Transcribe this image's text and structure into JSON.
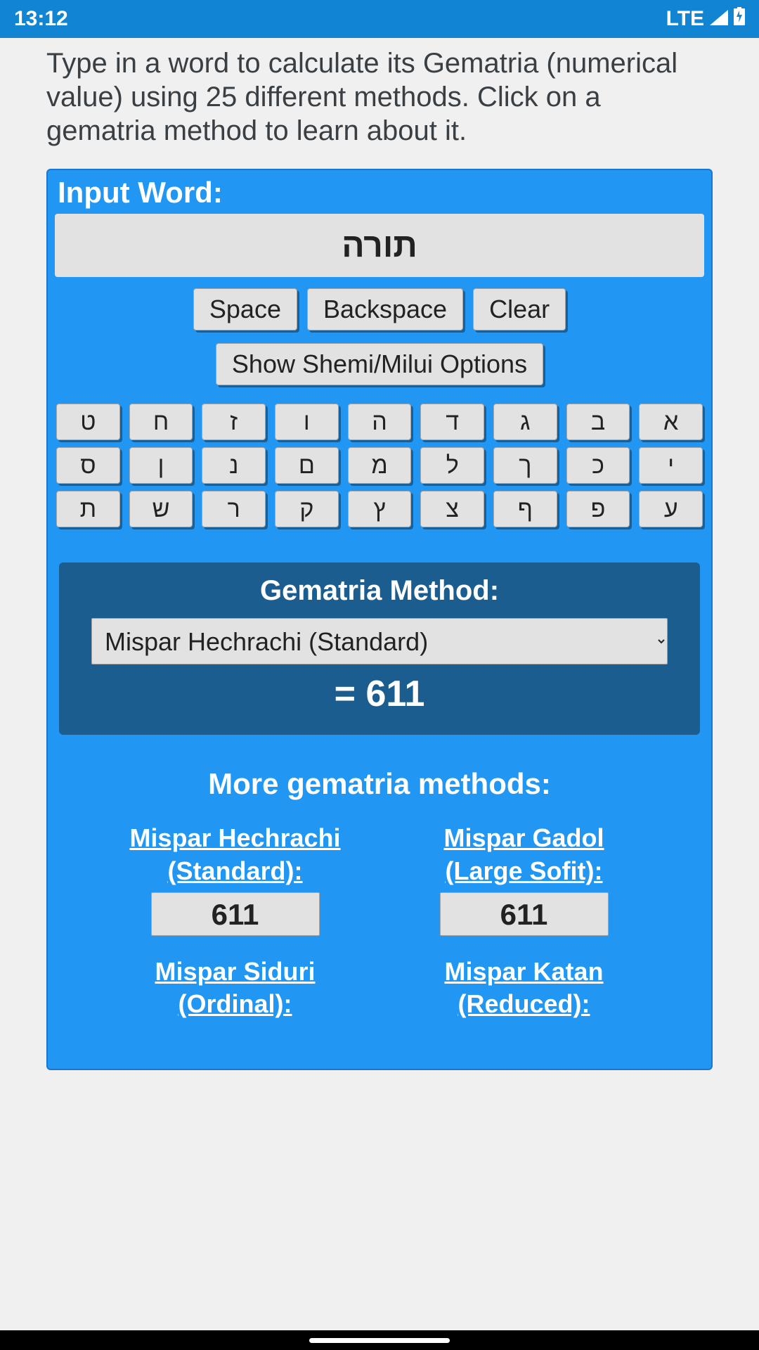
{
  "status": {
    "time": "13:12",
    "network": "LTE"
  },
  "intro": "Type in a word to calculate its Gematria (numerical value) using 25 different methods. Click on a gematria method to learn about it.",
  "input": {
    "label": "Input Word:",
    "value": "תורה"
  },
  "buttons": {
    "space": "Space",
    "backspace": "Backspace",
    "clear": "Clear",
    "shemi": "Show Shemi/Milui Options"
  },
  "hebrew_rows": [
    [
      "ט",
      "ח",
      "ז",
      "ו",
      "ה",
      "ד",
      "ג",
      "ב",
      "א"
    ],
    [
      "ס",
      "ן",
      "נ",
      "ם",
      "מ",
      "ל",
      "ך",
      "כ",
      "י"
    ],
    [
      "ת",
      "ש",
      "ר",
      "ק",
      "ץ",
      "צ",
      "ף",
      "פ",
      "ע"
    ]
  ],
  "method_panel": {
    "label": "Gematria Method:",
    "selected": "Mispar Hechrachi (Standard)",
    "result_prefix": "= ",
    "result_value": "611"
  },
  "more_label": "More gematria methods:",
  "methods": [
    {
      "name": "Mispar Hechrachi",
      "sub": "(Standard):",
      "value": "611"
    },
    {
      "name": "Mispar Gadol",
      "sub": "(Large Sofit):",
      "value": "611"
    },
    {
      "name": "Mispar Siduri",
      "sub": "(Ordinal):",
      "value": ""
    },
    {
      "name": "Mispar Katan",
      "sub": "(Reduced):",
      "value": ""
    }
  ]
}
